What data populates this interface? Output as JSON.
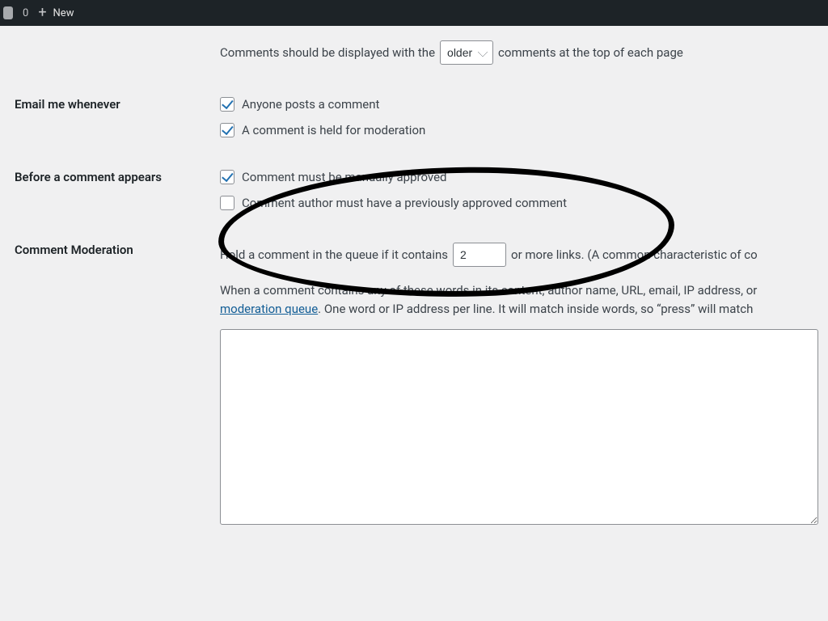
{
  "adminbar": {
    "count": "0",
    "new_label": "New"
  },
  "display_order": {
    "prefix": "Comments should be displayed with the",
    "select_value": "older",
    "suffix": "comments at the top of each page"
  },
  "sections": {
    "email": {
      "heading": "Email me whenever",
      "opt1": "Anyone posts a comment",
      "opt2": "A comment is held for moderation"
    },
    "before": {
      "heading": "Before a comment appears",
      "opt1": "Comment must be manually approved",
      "opt2": "Comment author must have a previously approved comment"
    },
    "moderation": {
      "heading": "Comment Moderation",
      "links_prefix": "Hold a comment in the queue if it contains",
      "links_value": "2",
      "links_suffix": "or more links. (A common characteristic of co",
      "para_before_link": "When a comment contains any of these words in its content, author name, URL, email, IP address, or",
      "link_text": "moderation queue",
      "para_after_link": ". One word or IP address per line. It will match inside words, so “press” will match "
    }
  }
}
